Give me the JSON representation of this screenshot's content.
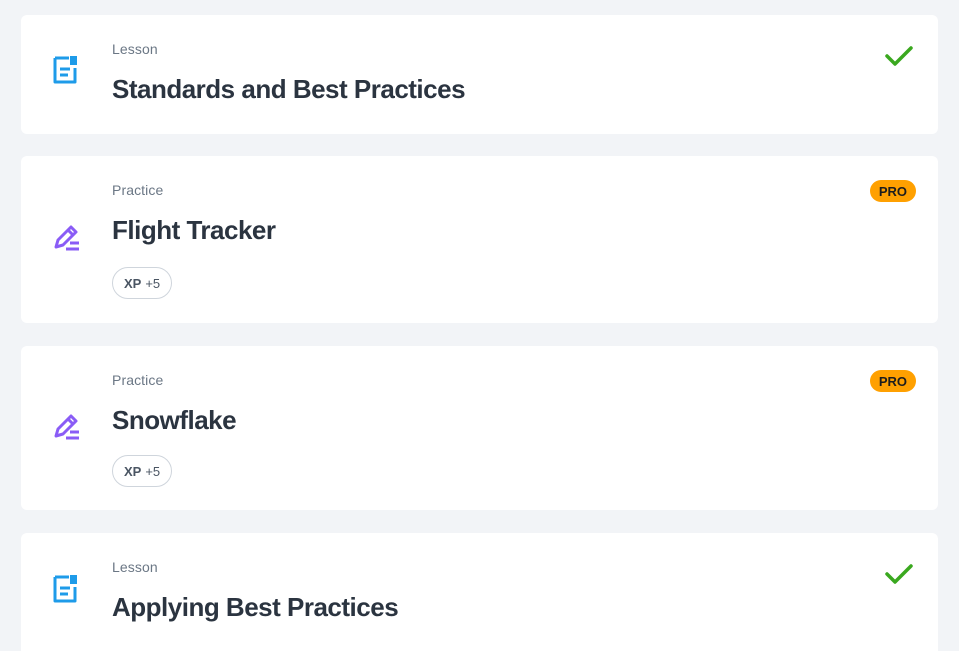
{
  "colors": {
    "lesson_icon": "#1e9be9",
    "practice_icon": "#8a5cf6",
    "check": "#3aa81f",
    "pro_badge_bg": "#ffa000"
  },
  "items": [
    {
      "kind": "Lesson",
      "title": "Standards and Best Practices",
      "icon": "lesson-document-icon",
      "status": "completed"
    },
    {
      "kind": "Practice",
      "title": "Flight Tracker",
      "icon": "practice-pencil-icon",
      "badge": "PRO",
      "xp_label": "XP",
      "xp_value": "+5"
    },
    {
      "kind": "Practice",
      "title": "Snowflake",
      "icon": "practice-pencil-icon",
      "badge": "PRO",
      "xp_label": "XP",
      "xp_value": "+5"
    },
    {
      "kind": "Lesson",
      "title": "Applying Best Practices",
      "icon": "lesson-document-icon",
      "status": "completed"
    }
  ]
}
